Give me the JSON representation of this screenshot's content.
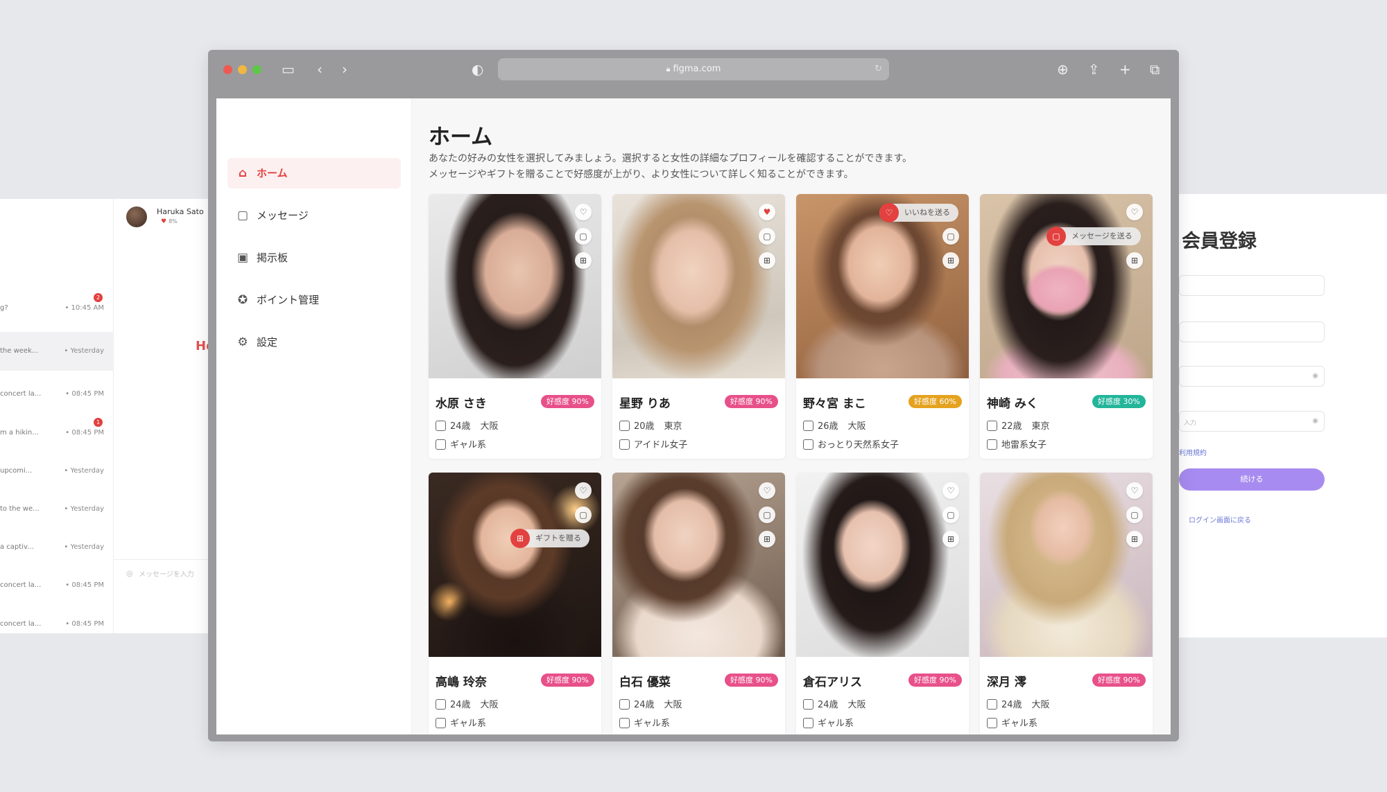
{
  "browser": {
    "url": "figma.com"
  },
  "sidebar": {
    "items": [
      {
        "label": "ホーム",
        "icon": "home-icon"
      },
      {
        "label": "メッセージ",
        "icon": "message-icon"
      },
      {
        "label": "掲示板",
        "icon": "board-icon"
      },
      {
        "label": "ポイント管理",
        "icon": "points-icon"
      },
      {
        "label": "設定",
        "icon": "settings-icon"
      }
    ]
  },
  "main": {
    "title": "ホーム",
    "description_line1": "あなたの好みの女性を選択してみましょう。選択すると女性の詳細なプロフィールを確認することができます。",
    "description_line2": "メッセージやギフトを贈ることで好感度が上がり、より女性について詳しく知ることができます。"
  },
  "tooltips": {
    "like": "いいねを送る",
    "message": "メッセージを送る",
    "gift": "ギフトを贈る"
  },
  "profiles": [
    {
      "name": "水原 さき",
      "affinity": "好感度 90%",
      "age": "24歳",
      "area": "大阪",
      "type": "ギャル系",
      "affinity_color": "#e8508a",
      "liked": false
    },
    {
      "name": "星野 りあ",
      "affinity": "好感度 90%",
      "age": "20歳",
      "area": "東京",
      "type": "アイドル女子",
      "affinity_color": "#e8508a",
      "liked": true
    },
    {
      "name": "野々宮 まこ",
      "affinity": "好感度 60%",
      "age": "26歳",
      "area": "大阪",
      "type": "おっとり天然系女子",
      "affinity_color": "#e5a21f",
      "liked": false
    },
    {
      "name": "神崎 みく",
      "affinity": "好感度 30%",
      "age": "22歳",
      "area": "東京",
      "type": "地雷系女子",
      "affinity_color": "#22b59a",
      "liked": false
    },
    {
      "name": "高嶋 玲奈",
      "affinity": "好感度 90%",
      "age": "24歳",
      "area": "大阪",
      "type": "ギャル系",
      "affinity_color": "#e8508a",
      "liked": false
    },
    {
      "name": "白石 優菜",
      "affinity": "好感度 90%",
      "age": "24歳",
      "area": "大阪",
      "type": "ギャル系",
      "affinity_color": "#e8508a",
      "liked": false
    },
    {
      "name": "倉石アリス",
      "affinity": "好感度 90%",
      "age": "24歳",
      "area": "大阪",
      "type": "ギャル系",
      "affinity_color": "#e8508a",
      "liked": false
    },
    {
      "name": "深月 澪",
      "affinity": "好感度 90%",
      "age": "24歳",
      "area": "大阪",
      "type": "ギャル系",
      "affinity_color": "#e8508a",
      "liked": false
    }
  ],
  "bg_chat": {
    "contact_name": "Haruka Sato",
    "contact_affinity": "8%",
    "greeting": "Ho",
    "input_placeholder": "メッセージを入力",
    "conversations": [
      {
        "preview": "g?",
        "time": "• 10:45 AM",
        "badge": "2"
      },
      {
        "preview": "the week...",
        "time": "• Yesterday",
        "badge": ""
      },
      {
        "preview": "concert la...",
        "time": "• 08:45 PM",
        "badge": ""
      },
      {
        "preview": "m a hikin...",
        "time": "• 08:45 PM",
        "badge": "1"
      },
      {
        "preview": "upcomi...",
        "time": "• Yesterday",
        "badge": ""
      },
      {
        "preview": "to the we...",
        "time": "• Yesterday",
        "badge": ""
      },
      {
        "preview": "a captiv...",
        "time": "• Yesterday",
        "badge": ""
      },
      {
        "preview": "concert la...",
        "time": "• 08:45 PM",
        "badge": ""
      },
      {
        "preview": "concert la...",
        "time": "• 08:45 PM",
        "badge": ""
      }
    ]
  },
  "bg_signup": {
    "title": "会員登録",
    "field3_placeholder": "",
    "field4_placeholder": "入力",
    "field2_placeholder": "",
    "terms_link": "利用規約",
    "continue_label": "続ける",
    "back_link": "ログイン画面に戻る"
  }
}
